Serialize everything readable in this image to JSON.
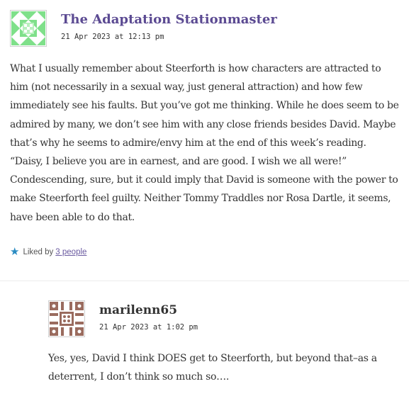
{
  "comments": [
    {
      "author": "The Adaptation Stationmaster",
      "timestamp": "21 Apr 2023 at 12:13 pm",
      "avatar_icon": "identicon-green",
      "avatar_color": "#7fe08a",
      "text": "What I usually remember about Steerforth is how characters are attracted to him (not necessarily in a sexual way, just general attraction) and how few immediately see his faults. But you’ve got me thinking. While he does seem to be admired by many, we don’t see him with any close friends besides David. Maybe that’s why he seems to admire/envy him at the end of this week’s reading. “Daisy, I believe you are in earnest, and are good. I wish we all were!” Condescending, sure, but it could imply that David is someone with the power to make Steerforth feel guilty. Neither Tommy Traddles nor Rosa Dartle, it seems, have been able to do that.",
      "likes": {
        "icon": "star-icon",
        "label": "Liked by",
        "link_text": "3 people"
      }
    },
    {
      "author": "marilenn65",
      "timestamp": "21 Apr 2023 at 1:02 pm",
      "avatar_icon": "identicon-brown",
      "avatar_color": "#9a6b5e",
      "text": "Yes, yes, David I think DOES get to Steerforth, but beyond that–as a deterrent, I don’t think so much so…."
    }
  ],
  "colors": {
    "author_link": "#5b4a92",
    "star": "#2a8bc2",
    "likes_link": "#6a5aa0"
  }
}
